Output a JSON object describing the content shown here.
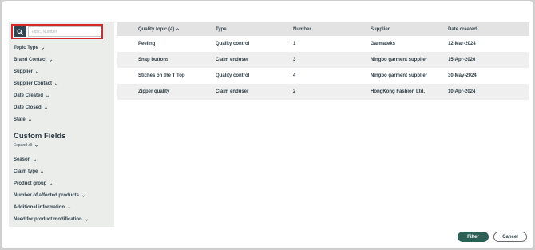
{
  "search": {
    "placeholder": "Topic, Number"
  },
  "filters": [
    {
      "label": "Topic Type"
    },
    {
      "label": "Brand Contact"
    },
    {
      "label": "Supplier"
    },
    {
      "label": "Supplier Contact"
    },
    {
      "label": "Date Created"
    },
    {
      "label": "Date Closed"
    },
    {
      "label": "State"
    }
  ],
  "custom_fields": {
    "title": "Custom Fields",
    "expand_all": "Expand all",
    "items": [
      {
        "label": "Season"
      },
      {
        "label": "Claim type"
      },
      {
        "label": "Product group"
      },
      {
        "label": "Number of affected products"
      },
      {
        "label": "Additional information"
      },
      {
        "label": "Need for product modification"
      }
    ]
  },
  "table": {
    "headers": {
      "quality_topic": "Quality topic (4)",
      "type": "Type",
      "number": "Number",
      "supplier": "Supplier",
      "date_created": "Date created"
    },
    "rows": [
      {
        "topic": "Peeling",
        "type": "Quality control",
        "number": "1",
        "supplier": "Garmateks",
        "date": "12-Mar-2024"
      },
      {
        "topic": "Snap buttons",
        "type": "Claim enduser",
        "number": "3",
        "supplier": "Ningbo garment supplier",
        "date": "15-Apr-2026"
      },
      {
        "topic": "Stiches on the T Top",
        "type": "Quality control",
        "number": "4",
        "supplier": "Ningbo garment supplier",
        "date": "30-May-2024"
      },
      {
        "topic": "Zipper quality",
        "type": "Claim enduser",
        "number": "2",
        "supplier": "HongKong Fashion Ltd.",
        "date": "10-Apr-2024"
      }
    ]
  },
  "footer": {
    "filter_label": "Filter",
    "cancel_label": "Cancel"
  },
  "colors": {
    "accent": "#2c5f55",
    "highlight": "#d62a2a",
    "sidebar_bg": "#ebedeb"
  }
}
